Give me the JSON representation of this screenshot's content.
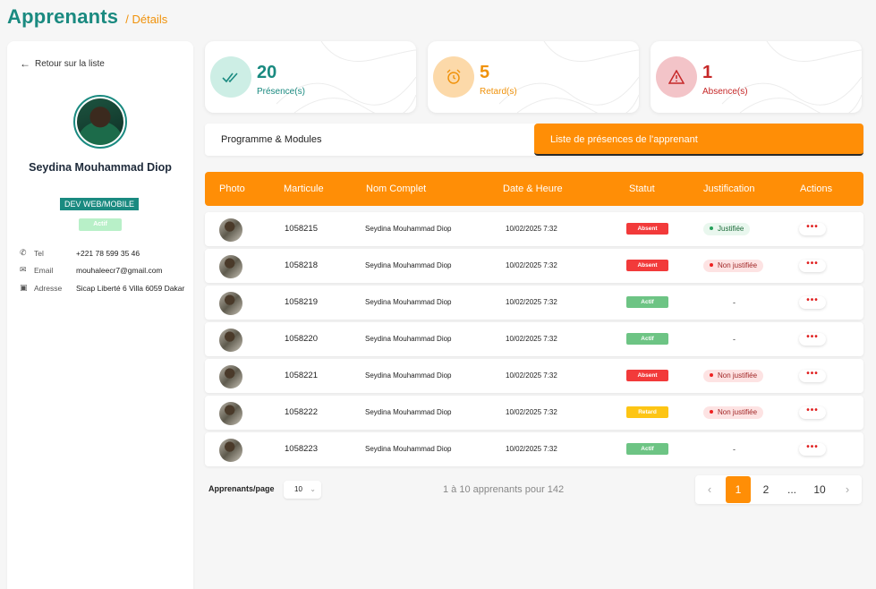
{
  "header": {
    "title": "Apprenants",
    "subtitle": "/ Détails"
  },
  "sidebar": {
    "back_label": "Retour sur la liste",
    "name": "Seydina Mouhammad Diop",
    "role": "DEV WEB/MOBILE",
    "status": "Actif",
    "info": [
      {
        "icon": "phone-icon",
        "label": "Tel",
        "value": "+221 78 599 35 46"
      },
      {
        "icon": "email-icon",
        "label": "Email",
        "value": "mouhaleecr7@gmail.com"
      },
      {
        "icon": "address-icon",
        "label": "Adresse",
        "value": "Sicap Liberté 6 Villa 6059 Dakar"
      }
    ]
  },
  "stats": [
    {
      "value": "20",
      "label": "Présence(s)",
      "color": "#1a8a80",
      "bg": "#cdeee5",
      "icon": "double-check-icon"
    },
    {
      "value": "5",
      "label": "Retard(s)",
      "color": "#f0920b",
      "bg": "#fcd9a9",
      "icon": "alarm-clock-icon"
    },
    {
      "value": "1",
      "label": "Absence(s)",
      "color": "#c62828",
      "bg": "#f3c4c8",
      "icon": "warning-icon"
    }
  ],
  "tabs": [
    "Programme & Modules",
    "Liste de présences de l'apprenant"
  ],
  "table": {
    "headers": [
      "Photo",
      "Marticule",
      "Nom Complet",
      "Date & Heure",
      "Statut",
      "Justification",
      "Actions"
    ],
    "rows": [
      {
        "matricule": "1058215",
        "nom": "Seydina Mouhammad Diop",
        "date": "10/02/2025 7:32",
        "statut": "Absent",
        "justification": "Justifiée"
      },
      {
        "matricule": "1058218",
        "nom": "Seydina Mouhammad Diop",
        "date": "10/02/2025 7:32",
        "statut": "Absent",
        "justification": "Non justifiée"
      },
      {
        "matricule": "1058219",
        "nom": "Seydina Mouhammad Diop",
        "date": "10/02/2025 7:32",
        "statut": "Actif",
        "justification": "-"
      },
      {
        "matricule": "1058220",
        "nom": "Seydina Mouhammad Diop",
        "date": "10/02/2025 7:32",
        "statut": "Actif",
        "justification": "-"
      },
      {
        "matricule": "1058221",
        "nom": "Seydina Mouhammad Diop",
        "date": "10/02/2025 7:32",
        "statut": "Absent",
        "justification": "Non justifiée"
      },
      {
        "matricule": "1058222",
        "nom": "Seydina Mouhammad Diop",
        "date": "10/02/2025 7:32",
        "statut": "Retard",
        "justification": "Non justifiée"
      },
      {
        "matricule": "1058223",
        "nom": "Seydina Mouhammad Diop",
        "date": "10/02/2025 7:32",
        "statut": "Actif",
        "justification": "-"
      }
    ],
    "actions_label": "•••"
  },
  "status_colors": {
    "Absent": "#f23a3a",
    "Actif": "#6dc484",
    "Retard": "#fdc514"
  },
  "footer": {
    "per_page_label": "Apprenants/page",
    "per_page_value": "10",
    "range_text": "1 à 10 apprenants pour 142",
    "pages": [
      "1",
      "2",
      "...",
      "10"
    ],
    "active_page": "1"
  }
}
